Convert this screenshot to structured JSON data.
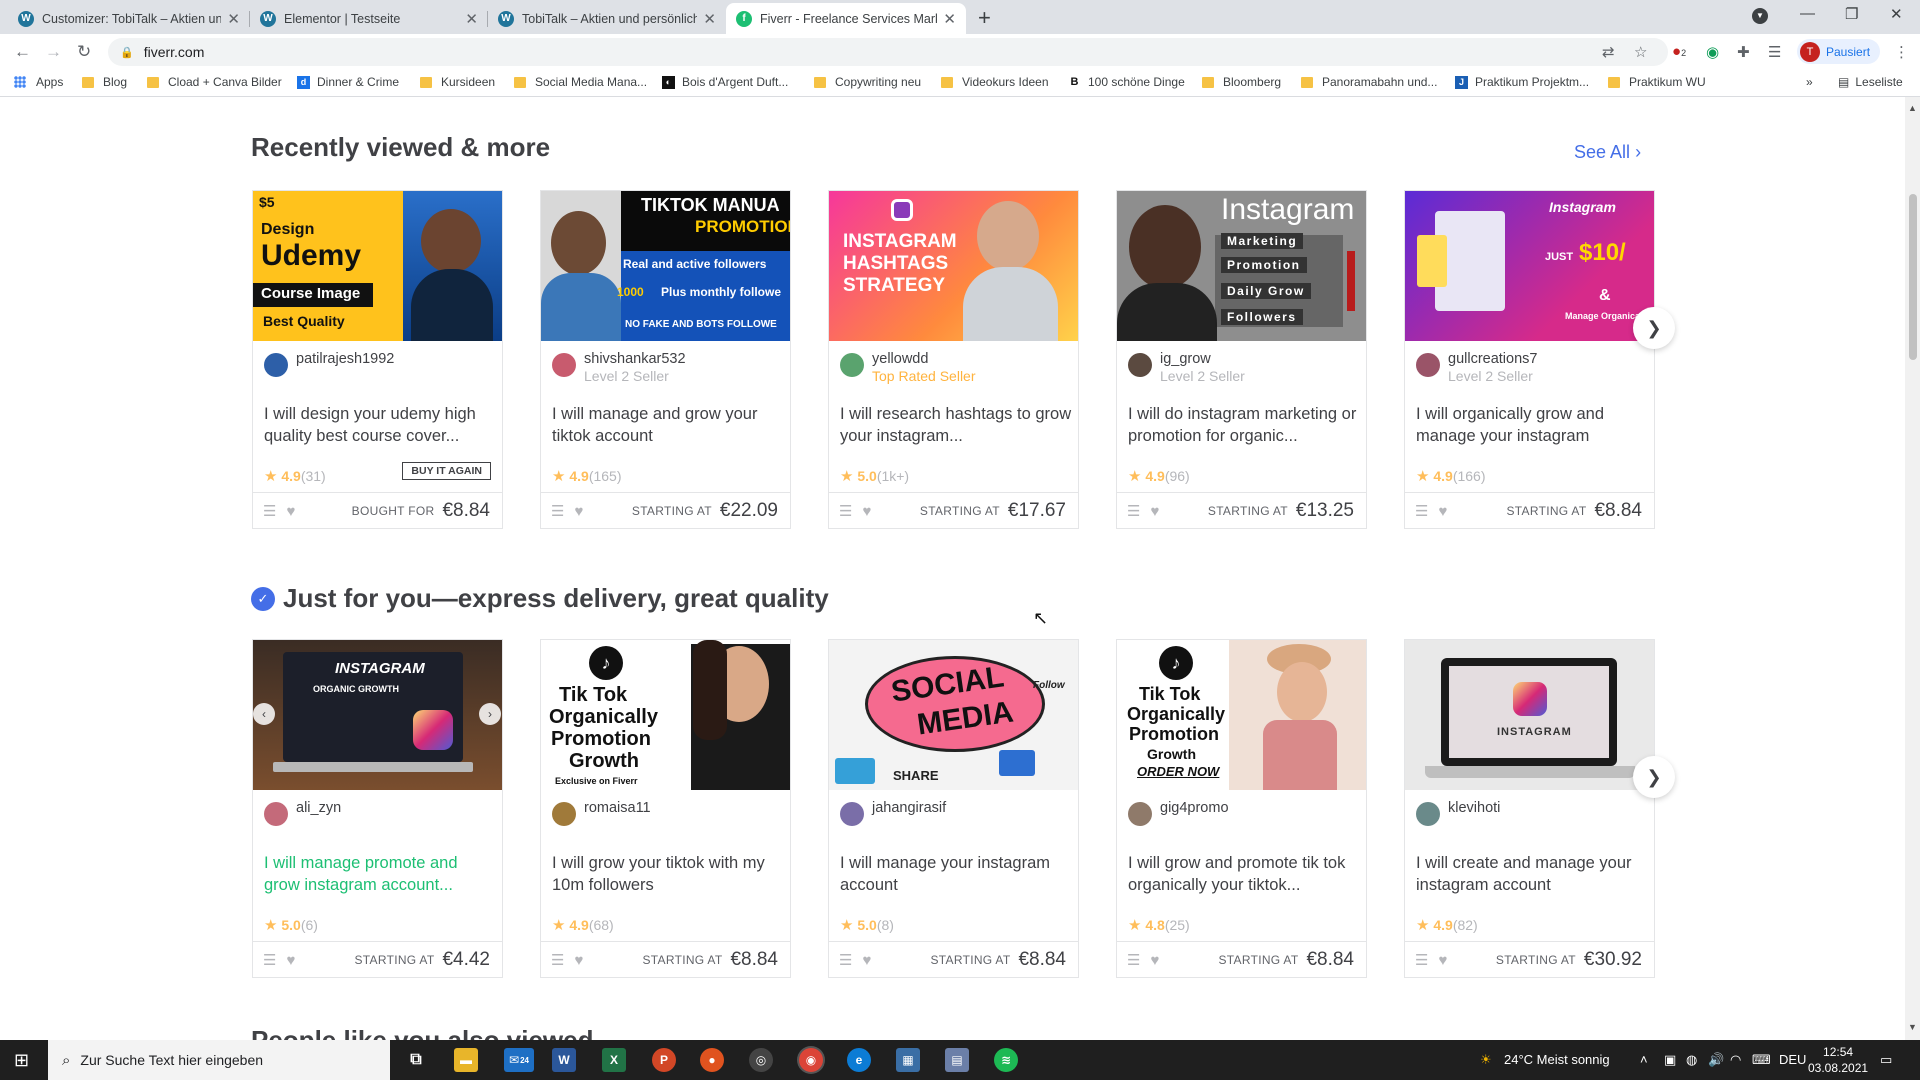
{
  "browser": {
    "tabs": [
      {
        "title": "Customizer: TobiTalk – Aktien und",
        "favicon": "wordpress-icon"
      },
      {
        "title": "Elementor | Testseite",
        "favicon": "wordpress-icon"
      },
      {
        "title": "TobiTalk – Aktien und persönliche",
        "favicon": "wordpress-icon"
      },
      {
        "title": "Fiverr - Freelance Services Marke",
        "favicon": "fiverr-icon"
      }
    ],
    "url": "fiverr.com",
    "profile_initial": "T",
    "profile_label": "Pausiert",
    "extension_badge": "2",
    "bookmarks": [
      "Apps",
      "Blog",
      "Cload + Canva Bilder",
      "Dinner & Crime",
      "Kursideen",
      "Social Media Mana...",
      "Bois d'Argent Duft...",
      "Copywriting neu",
      "Videokurs Ideen",
      "100 schöne Dinge",
      "Bloomberg",
      "Panoramabahn und...",
      "Praktikum Projektm...",
      "Praktikum WU"
    ],
    "more_bookmarks": "»",
    "reading_list": "Leseliste"
  },
  "recent": {
    "title": "Recently viewed & more",
    "see_all": "See All",
    "thumbs": {
      "t1": {
        "price": "$5",
        "l1": "Design",
        "l2": "Udemy",
        "l3": "Course Image",
        "l4": "Best Quality"
      },
      "t2": {
        "l1": "TIKTOK MANUA",
        "l2": "PROMOTION",
        "l3": "Real and active followers",
        "l4": "1000",
        "l5": "Plus monthly followe",
        "l6": "NO FAKE AND BOTS FOLLOWE"
      },
      "t3": {
        "l1": "INSTAGRAM",
        "l2": "HASHTAGS",
        "l3": "STRATEGY"
      },
      "t4": {
        "l1": "Instagram",
        "l2": "Marketing",
        "l3": "Promotion",
        "l4": "Daily Grow",
        "l5": "Followers"
      },
      "t5": {
        "l1": "Instagram",
        "l2": "JUST",
        "l3": "$10/",
        "l4": "&",
        "l5": "Manage Organically"
      }
    },
    "cards": [
      {
        "seller": "patilrajesh1992",
        "level": "",
        "title": "I will design your udemy high quality best course cover...",
        "score": "4.9",
        "count": "(31)",
        "badge": "BUY IT AGAIN",
        "price_label": "BOUGHT FOR",
        "price": "€8.84"
      },
      {
        "seller": "shivshankar532",
        "level": "Level 2 Seller",
        "title": "I will manage and grow your tiktok account",
        "score": "4.9",
        "count": "(165)",
        "price_label": "STARTING AT",
        "price": "€22.09"
      },
      {
        "seller": "yellowdd",
        "level": "Top Rated Seller",
        "title": "I will research hashtags to grow your instagram...",
        "score": "5.0",
        "count": "(1k+)",
        "price_label": "STARTING AT",
        "price": "€17.67"
      },
      {
        "seller": "ig_grow",
        "level": "Level 2 Seller",
        "title": "I will do instagram marketing or promotion for organic...",
        "score": "4.9",
        "count": "(96)",
        "price_label": "STARTING AT",
        "price": "€13.25"
      },
      {
        "seller": "gullcreations7",
        "level": "Level 2 Seller",
        "title": "I will organically grow and manage your instagram",
        "score": "4.9",
        "count": "(166)",
        "price_label": "STARTING AT",
        "price": "€8.84"
      }
    ]
  },
  "express": {
    "title": "Just for you—express delivery, great quality",
    "thumbs": {
      "t1": {
        "l1": "INSTAGRAM",
        "l2": "ORGANIC GROWTH"
      },
      "t2": {
        "l1": "Tik Tok",
        "l2": "Organically",
        "l3": "Promotion",
        "l4": "Growth",
        "l5": "Exclusive on Fiverr"
      },
      "t3": {
        "l1": "SOCIAL",
        "l2": "MEDIA",
        "l3": "SHARE",
        "l4": "Follow"
      },
      "t4": {
        "l1": "Tik Tok",
        "l2": "Organically",
        "l3": "Promotion",
        "l4": "Growth",
        "l5": "ORDER NOW"
      },
      "t5": {
        "l1": "INSTAGRAM"
      }
    },
    "cards": [
      {
        "seller": "ali_zyn",
        "title": "I will manage promote and grow instagram account...",
        "score": "5.0",
        "count": "(6)",
        "price_label": "STARTING AT",
        "price": "€4.42"
      },
      {
        "seller": "romaisa11",
        "title": "I will grow your tiktok with my 10m followers",
        "score": "4.9",
        "count": "(68)",
        "price_label": "STARTING AT",
        "price": "€8.84"
      },
      {
        "seller": "jahangirasif",
        "title": "I will manage your instagram account",
        "score": "5.0",
        "count": "(8)",
        "price_label": "STARTING AT",
        "price": "€8.84"
      },
      {
        "seller": "gig4promo",
        "title": "I will grow and promote tik tok organically your tiktok...",
        "score": "4.8",
        "count": "(25)",
        "price_label": "STARTING AT",
        "price": "€8.84"
      },
      {
        "seller": "klevihoti",
        "title": "I will create and manage your instagram account",
        "score": "4.9",
        "count": "(82)",
        "price_label": "STARTING AT",
        "price": "€30.92"
      }
    ]
  },
  "next_section_partial": "People like you also viewed",
  "taskbar": {
    "search_placeholder": "Zur Suche Text hier eingeben",
    "mail_badge": "24",
    "weather": "24°C  Meist sonnig",
    "lang": "DEU",
    "time": "12:54",
    "date": "03.08.2021"
  },
  "colors": {
    "fiverr_green": "#1dbf73",
    "link_blue": "#446ee7",
    "star": "#ffbe5b",
    "top_rated": "#ffb33e"
  }
}
